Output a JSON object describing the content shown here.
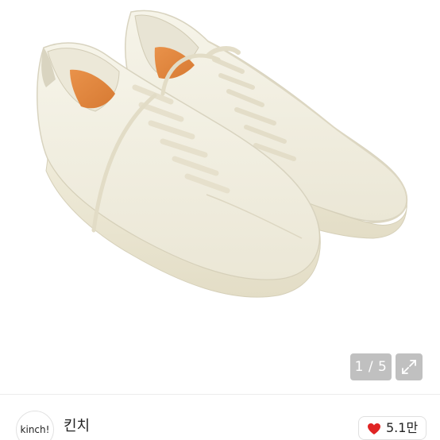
{
  "product_image": {
    "alt_icon": "sneaker-photo",
    "counter": "1 / 5",
    "expand_icon": "expand-icon"
  },
  "seller": {
    "avatar_text": "kinch!",
    "name": "킨치"
  },
  "likes": {
    "icon": "heart-icon",
    "count": "5.1만",
    "heart_color": "#e02424"
  }
}
